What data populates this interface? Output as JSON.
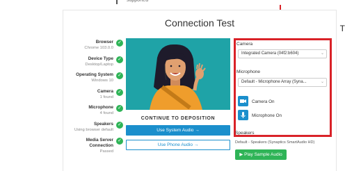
{
  "top_snippet": "supported",
  "title": "Connection Test",
  "right_mark": "T",
  "checks": [
    {
      "label": "Browser",
      "value": "Chrome 103.0.0"
    },
    {
      "label": "Device Type",
      "value": "Desktop/Laptop"
    },
    {
      "label": "Operating System",
      "value": "Windows 10"
    },
    {
      "label": "Camera",
      "value": "1 found"
    },
    {
      "label": "Microphone",
      "value": "4 found"
    },
    {
      "label": "Speakers",
      "value": "Using browser default"
    },
    {
      "label": "Media Server Connection",
      "value": "Passed"
    }
  ],
  "continue_label": "CONTINUE TO DEPOSITION",
  "system_audio_label": "Use System Audio →",
  "phone_audio_label": "Use Phone Audio →",
  "camera": {
    "label": "Camera",
    "selected": "Integrated Camera (04f2:b604)"
  },
  "microphone": {
    "label": "Microphone",
    "selected": "Default - Microphone Array (Syna..."
  },
  "camera_toggle_label": "Camera On",
  "mic_toggle_label": "Microphone On",
  "speakers": {
    "label": "Speakers",
    "value": "Default - Speakers (Synaptics SmartAudio HD)"
  },
  "play_sample_label": "Play Sample Audio",
  "colors": {
    "accent_blue": "#1b8fcc",
    "success_green": "#2fb457",
    "highlight_red": "#d92228",
    "video_bg": "#1fa3a7"
  }
}
